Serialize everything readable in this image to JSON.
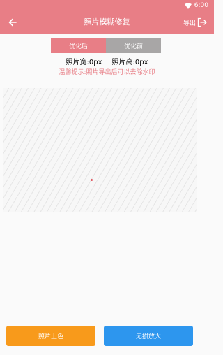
{
  "status_bar": {
    "time": "6:00"
  },
  "toolbar": {
    "title": "照片模糊修复",
    "export_label": "导出"
  },
  "tabs": [
    {
      "label": "优化后",
      "selected": true
    },
    {
      "label": "优化前",
      "selected": false
    }
  ],
  "photo_info": {
    "width_text": "照片宽:0px",
    "height_text": "照片高:0px"
  },
  "tip": "温馨提示:照片导出后可以去除水印",
  "buttons": {
    "colorize": "照片上色",
    "enlarge": "无损放大"
  },
  "colors": {
    "accent": "#e87e86",
    "tab_inactive": "#a8a6a6",
    "colorize_button": "#f89a1b",
    "enlarge_button": "#2d96ee"
  }
}
